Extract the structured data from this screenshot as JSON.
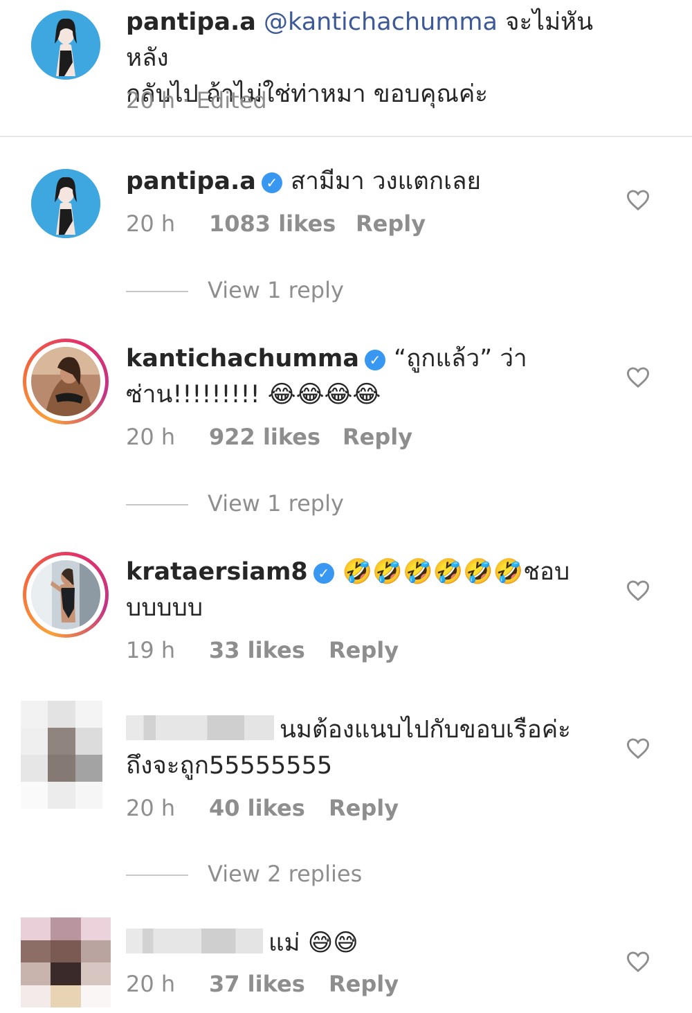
{
  "caption": {
    "username": "pantipa.a",
    "mention": "@kantichachumma",
    "text_line1": "จะไม่หันหลัง",
    "text_line2": "กลับไป ถ้าไม่ใช่ท่าหมา ขอบคุณค่ะ",
    "meta": "20 h · Edited"
  },
  "comments": [
    {
      "username": "pantipa.a",
      "verified": true,
      "text": "สามีมา วงแตกเลย",
      "time": "20 h",
      "likes": "1083 likes",
      "reply": "Reply",
      "view_replies": "View 1 reply"
    },
    {
      "username": "kantichachumma",
      "verified": true,
      "text_line1": "“ถูกแล้ว” ว่า",
      "text_line2": "ซ่าน!!!!!!!!! 😂😂😂😂",
      "time": "20 h",
      "likes": "922 likes",
      "reply": "Reply",
      "view_replies": "View 1 reply"
    },
    {
      "username": "krataersiam8",
      "verified": true,
      "text_line1": "🤣🤣🤣🤣🤣🤣ชอบ",
      "text_line2": "บบบบบ",
      "time": "19 h",
      "likes": "33 likes",
      "reply": "Reply"
    },
    {
      "username_hidden": true,
      "text_line1": "นมต้องแนบไปกับขอบเรือค่ะ",
      "text_line2": "ถึงจะถูก55555555",
      "time": "20 h",
      "likes": "40 likes",
      "reply": "Reply",
      "view_replies": "View 2 replies"
    },
    {
      "username_hidden": true,
      "text": "แม่ 😅😅",
      "time": "20 h",
      "likes": "37 likes",
      "reply": "Reply"
    }
  ],
  "icons": {
    "heart": "heart-outline-icon",
    "verified": "verified-badge-icon"
  },
  "colors": {
    "username": "#262626",
    "mention": "#3d5a97",
    "meta": "#8e8e8e",
    "verified": "#3897f0"
  }
}
